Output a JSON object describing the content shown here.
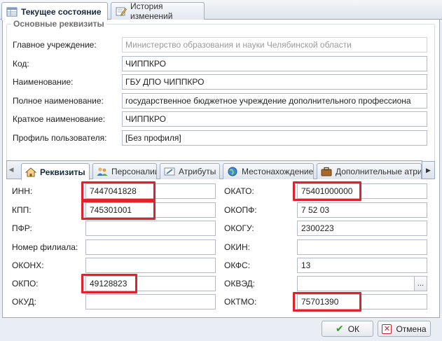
{
  "top_tabs": [
    {
      "label": "Текущее состояние",
      "icon": "table-icon",
      "active": true
    },
    {
      "label": "История изменений",
      "icon": "edit-history-icon",
      "active": false
    }
  ],
  "main": {
    "legend": "Основные реквизиты",
    "fields": [
      {
        "label": "Главное учреждение:",
        "value": "Министерство образования и науки Челябинской области",
        "disabled": true
      },
      {
        "label": "Код:",
        "value": "ЧИППКРО"
      },
      {
        "label": "Наименование:",
        "value": "ГБУ ДПО ЧИППКРО"
      },
      {
        "label": "Полное наименование:",
        "value": "государственное бюджетное учреждение дополнительного профессиона"
      },
      {
        "label": "Краткое наименование:",
        "value": "ЧИППКРО"
      },
      {
        "label": "Профиль пользователя:",
        "value": "[Без профиля]"
      }
    ]
  },
  "sub_tabs": [
    {
      "label": "Реквизиты",
      "icon": "home-icon",
      "active": true
    },
    {
      "label": "Персоналии",
      "icon": "users-icon",
      "active": false
    },
    {
      "label": "Атрибуты",
      "icon": "attributes-icon",
      "active": false
    },
    {
      "label": "Местонахождение",
      "icon": "globe-icon",
      "active": false
    },
    {
      "label": "Дополнительные атриб",
      "icon": "briefcase-icon",
      "active": false
    }
  ],
  "requisites": {
    "left": [
      {
        "label": "ИНН:",
        "value": "7447041828",
        "highlighted": true
      },
      {
        "label": "КПП:",
        "value": "745301001",
        "highlighted": true
      },
      {
        "label": "ПФР:",
        "value": "",
        "highlighted": false
      },
      {
        "label": "Номер филиала:",
        "value": "",
        "highlighted": false
      },
      {
        "label": "ОКОНХ:",
        "value": "",
        "highlighted": false
      },
      {
        "label": "ОКПО:",
        "value": "49128823",
        "highlighted": true
      },
      {
        "label": "ОКУД:",
        "value": "",
        "highlighted": false
      }
    ],
    "right": [
      {
        "label": "ОКАТО:",
        "value": "75401000000",
        "highlighted": true
      },
      {
        "label": "ОКОПФ:",
        "value": "7 52 03",
        "highlighted": false
      },
      {
        "label": "ОКОГУ:",
        "value": "2300223",
        "highlighted": false
      },
      {
        "label": "ОКИН:",
        "value": "",
        "highlighted": false
      },
      {
        "label": "ОКФС:",
        "value": "13",
        "highlighted": false
      },
      {
        "label": "ОКВЭД:",
        "value": "",
        "highlighted": false,
        "has_trigger": true
      },
      {
        "label": "ОКТМО:",
        "value": "75701390",
        "highlighted": true
      }
    ],
    "trigger_label": "..."
  },
  "buttons": {
    "ok": "ОК",
    "cancel": "Отмена"
  },
  "colors": {
    "highlight": "#e0232b",
    "border": "#99a9c0",
    "ok_icon": "#2f9a25",
    "cancel_icon": "#c8242b"
  }
}
